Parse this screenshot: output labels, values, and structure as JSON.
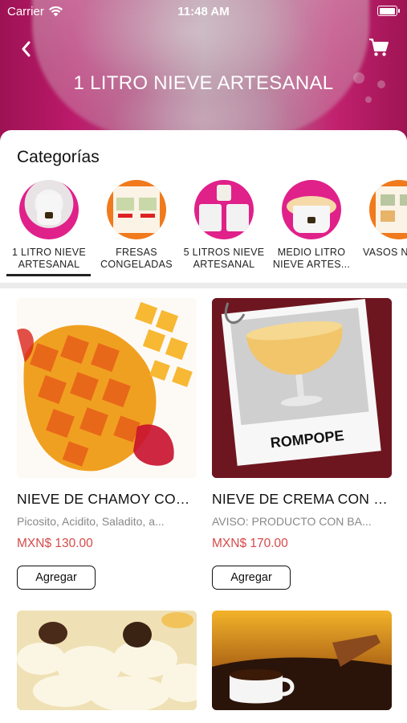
{
  "status_bar": {
    "carrier": "Carrier",
    "time": "11:48 AM",
    "battery_level": 1.0
  },
  "header": {
    "title": "1 LITRO NIEVE ARTESANAL",
    "back_icon": "chevron-left-icon",
    "cart_icon": "shopping-cart-icon"
  },
  "categories": {
    "title": "Categorías",
    "selected_index": 0,
    "items": [
      {
        "label": "1 LITRO NIEVE ARTESANAL"
      },
      {
        "label": "FRESAS CONGELADAS"
      },
      {
        "label": "5 LITROS NIEVE ARTESANAL"
      },
      {
        "label": "MEDIO LITRO NIEVE ARTES..."
      },
      {
        "label": "VASOS N"
      }
    ]
  },
  "products": [
    {
      "name": "NIEVE DE CHAMOY CON...",
      "description": "Picosito, Acidito, Saladito, a...",
      "price": "MXN$ 130.00",
      "button": "Agregar"
    },
    {
      "name": "NIEVE DE CREMA CON R...",
      "description": "AVISO: PRODUCTO CON BA...",
      "price": "MXN$ 170.00",
      "button": "Agregar",
      "image_text": "ROMPOPE"
    },
    {
      "name": "",
      "description": "",
      "price": "",
      "button": ""
    },
    {
      "name": "",
      "description": "",
      "price": "",
      "button": ""
    }
  ],
  "colors": {
    "price": "#d64a4a",
    "accent_pink": "#d81b7a"
  }
}
